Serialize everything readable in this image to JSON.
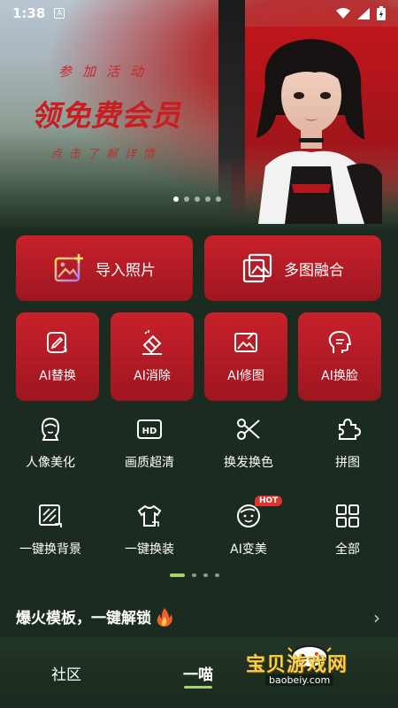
{
  "status_bar": {
    "time": "1:38",
    "indicator": "A"
  },
  "banner": {
    "kicker": "参加活动",
    "title": "领免费会员",
    "subtitle": "点击了解详情",
    "dot_count": 5,
    "active_dot": 0
  },
  "primary_actions": [
    {
      "label": "导入照片",
      "icon": "import-photo-icon"
    },
    {
      "label": "多图融合",
      "icon": "multi-image-icon"
    }
  ],
  "ai_actions": [
    {
      "label": "AI替换",
      "icon": "edit-swap-icon"
    },
    {
      "label": "AI消除",
      "icon": "eraser-icon"
    },
    {
      "label": "AI修图",
      "icon": "image-edit-icon"
    },
    {
      "label": "AI换脸",
      "icon": "face-swap-icon"
    }
  ],
  "tools": [
    {
      "label": "人像美化",
      "icon": "portrait-icon"
    },
    {
      "label": "画质超清",
      "icon": "hd-icon"
    },
    {
      "label": "换发换色",
      "icon": "scissors-icon"
    },
    {
      "label": "拼图",
      "icon": "puzzle-icon"
    },
    {
      "label": "一键换背景",
      "icon": "background-swap-icon"
    },
    {
      "label": "一键换装",
      "icon": "outfit-icon"
    },
    {
      "label": "AI变美",
      "icon": "beauty-face-icon",
      "badge": "HOT"
    },
    {
      "label": "全部",
      "icon": "grid-icon"
    }
  ],
  "section": {
    "title": "爆火模板，一键解锁",
    "icon": "fire-icon"
  },
  "tabs": [
    {
      "label": "社区"
    },
    {
      "label": "一喵"
    }
  ],
  "watermark": {
    "text": "宝贝游戏网",
    "url": "baobeiy.com"
  },
  "colors": {
    "accent_red": "#c8212b",
    "accent_green": "#a8d36a",
    "background": "#1c2b1f"
  }
}
